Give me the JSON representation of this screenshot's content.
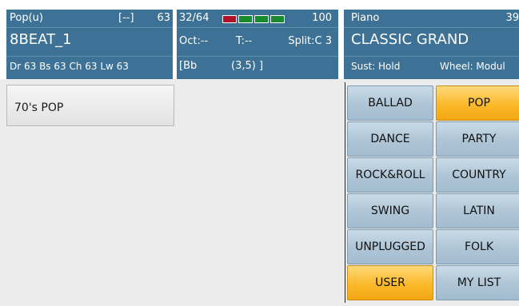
{
  "style": {
    "category": "Pop(u)",
    "bracket": "[--]",
    "number": "63",
    "name": "8BEAT_1",
    "parts": "Dr 63  Bs 63  Ch 63  Lw 63"
  },
  "status": {
    "measure": "32/64",
    "tempo": "100",
    "octave": "Oct:--",
    "transpose": "T:--",
    "split": "Split:C 3",
    "chord": "[Bb",
    "position": "(3,5) ]",
    "meter_colors": [
      "#b0122a",
      "#1a8a2e",
      "#1a8a2e",
      "#1a8a2e"
    ]
  },
  "voice": {
    "category": "Piano",
    "number": "39",
    "name": "CLASSIC GRAND",
    "sustain": "Sust: Hold",
    "wheel": "Wheel: Modul"
  },
  "song_list": [
    "70's POP"
  ],
  "genres": [
    {
      "label": "BALLAD",
      "active": false
    },
    {
      "label": "POP",
      "active": true
    },
    {
      "label": "DANCE",
      "active": false
    },
    {
      "label": "PARTY",
      "active": false
    },
    {
      "label": "ROCK&ROLL",
      "active": false
    },
    {
      "label": "COUNTRY",
      "active": false
    },
    {
      "label": "SWING",
      "active": false
    },
    {
      "label": "LATIN",
      "active": false
    },
    {
      "label": "UNPLUGGED",
      "active": false
    },
    {
      "label": "FOLK",
      "active": false
    },
    {
      "label": "USER",
      "active": true
    },
    {
      "label": "MY LIST",
      "active": false
    }
  ]
}
